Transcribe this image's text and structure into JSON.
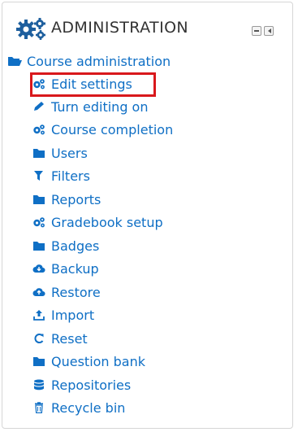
{
  "block": {
    "title": "ADMINISTRATION"
  },
  "root": {
    "label": "Course administration",
    "icon": "folder-open-icon"
  },
  "items": [
    {
      "label": "Edit settings",
      "icon": "cogs-icon"
    },
    {
      "label": "Turn editing on",
      "icon": "pencil-icon"
    },
    {
      "label": "Course completion",
      "icon": "cogs-icon"
    },
    {
      "label": "Users",
      "icon": "folder-icon"
    },
    {
      "label": "Filters",
      "icon": "filter-icon"
    },
    {
      "label": "Reports",
      "icon": "folder-icon"
    },
    {
      "label": "Gradebook setup",
      "icon": "cogs-icon"
    },
    {
      "label": "Badges",
      "icon": "folder-icon"
    },
    {
      "label": "Backup",
      "icon": "cloud-download-icon"
    },
    {
      "label": "Restore",
      "icon": "cloud-upload-icon"
    },
    {
      "label": "Import",
      "icon": "upload-icon"
    },
    {
      "label": "Reset",
      "icon": "reset-icon"
    },
    {
      "label": "Question bank",
      "icon": "folder-icon"
    },
    {
      "label": "Repositories",
      "icon": "database-icon"
    },
    {
      "label": "Recycle bin",
      "icon": "trash-icon"
    }
  ],
  "colors": {
    "link": "#0f6fc5",
    "highlight": "#d9181c",
    "title": "#333333"
  }
}
